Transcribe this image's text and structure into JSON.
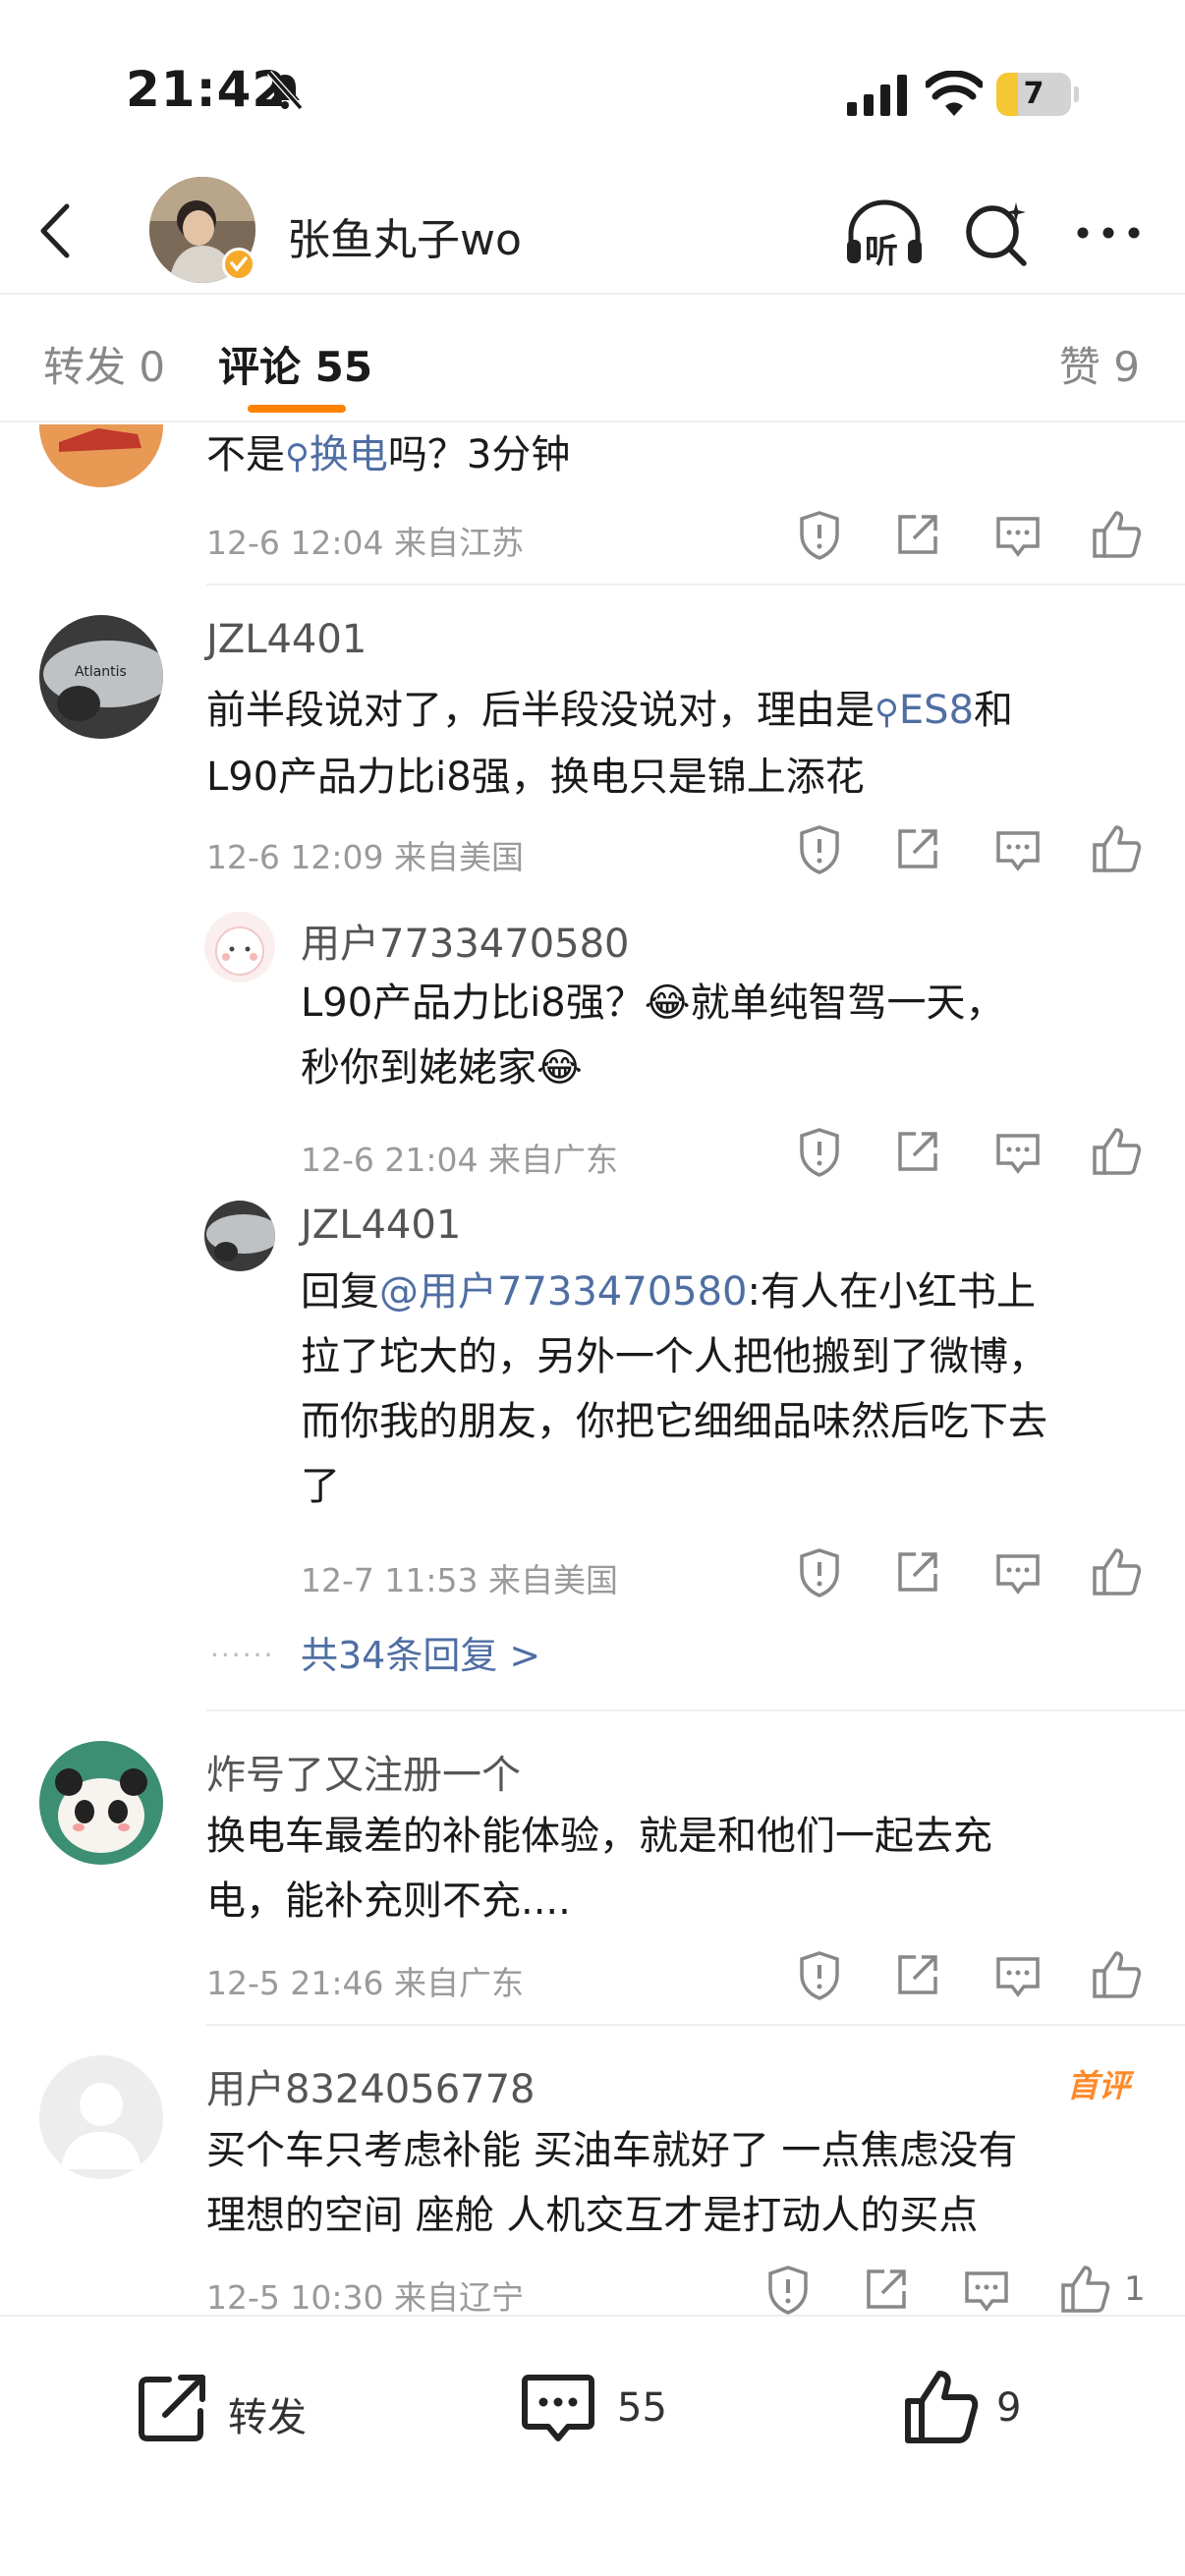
{
  "status_bar": {
    "time": "21:42",
    "battery": "7"
  },
  "header": {
    "username": "张鱼丸子wo",
    "listen_label": "听"
  },
  "tabs": {
    "repost": "转发 0",
    "comments": "评论 55",
    "likes": "赞 9"
  },
  "comments": [
    {
      "text_prefix": "不是",
      "link": "换电",
      "text_suffix": "吗？3分钟",
      "meta": "12-6 12:04  来自江苏"
    },
    {
      "username": "JZL4401",
      "text_prefix": "前半段说对了，后半段没说对，理由是",
      "link": "ES8",
      "text_mid": "和",
      "text_line2": "L90产品力比i8强，换电只是锦上添花",
      "meta": "12-6 12:09  来自美国",
      "replies": [
        {
          "username": "用户7733470580",
          "line1": "L90产品力比i8强？",
          "emoji1": "😂",
          "line1b": "就单纯智驾一天，",
          "line2": "秒你到姥姥家",
          "emoji2": "😂",
          "meta": "12-6 21:04  来自广东"
        },
        {
          "username": "JZL4401",
          "reply_prefix": "回复",
          "mention": "@用户7733470580",
          "line1": ":有人在小红书上",
          "line2": "拉了坨大的，另外一个人把他搬到了微博，",
          "line3": "而你我的朋友，你把它细细品味然后吃下去",
          "line4": "了",
          "meta": "12-7 11:53  来自美国"
        }
      ],
      "more_replies": "共34条回复 >"
    },
    {
      "username": "炸号了又注册一个",
      "line1": "换电车最差的补能体验，就是和他们一起去充",
      "line2": "电，能补充则不充....",
      "meta": "12-5 21:46  来自广东"
    },
    {
      "username": "用户8324056778",
      "badge": "首评",
      "line1": "买个车只考虑补能 买油车就好了 一点焦虑没有",
      "line2": "理想的空间 座舱 人机交互才是打动人的买点",
      "meta": "12-5 10:30  来自辽宁",
      "likes": "1"
    }
  ],
  "bottom_bar": {
    "repost": "转发",
    "comments": "55",
    "likes": "9"
  },
  "colors": {
    "accent": "#ff8200",
    "link": "#4f6ea3",
    "badge": "#ff8a2a"
  }
}
